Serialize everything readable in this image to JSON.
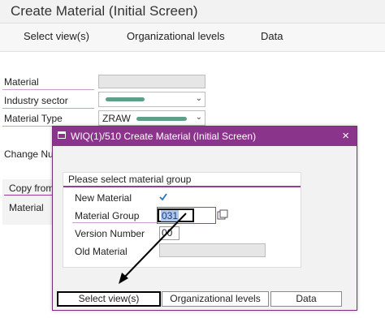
{
  "window": {
    "title": "Create Material (Initial Screen)"
  },
  "toolbar": {
    "select_views": "Select view(s)",
    "org_levels": "Organizational levels",
    "data": "Data"
  },
  "form": {
    "material_label": "Material",
    "industry_sector_label": "Industry sector",
    "material_type_label": "Material Type",
    "material_type_value": "ZRAW",
    "change_number_label": "Change Nu",
    "copy_from_label": "Copy from",
    "copy_material_label": "Material"
  },
  "dialog": {
    "title": "WIQ(1)/510 Create Material (Initial Screen)",
    "close": "×",
    "panel_title": "Please select material group",
    "new_material_label": "New Material",
    "material_group_label": "Material Group",
    "material_group_value": "031",
    "version_number_label": "Version Number",
    "version_number_value": "00",
    "old_material_label": "Old Material",
    "buttons": {
      "select_views": "Select view(s)",
      "org_levels": "Organizational levels",
      "data": "Data"
    }
  },
  "colors": {
    "dialog_header": "#8b348b",
    "accent_line": "#9a3a9a",
    "checkbox": "#2a6fc9"
  }
}
